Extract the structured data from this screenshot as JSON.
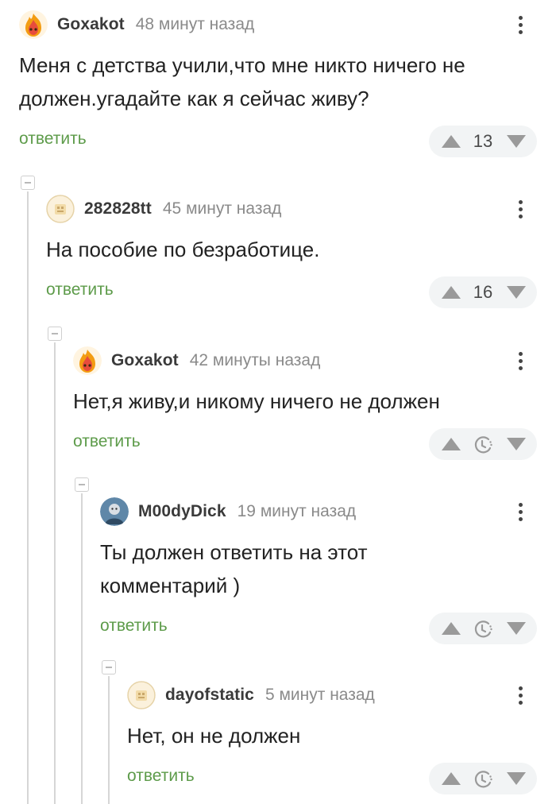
{
  "comments": [
    {
      "username": "Goxakot",
      "time": "48 минут назад",
      "text_lines": [
        "Меня с детства учили,что мне никто ничего не",
        "должен.угадайте как я сейчас живу?"
      ],
      "reply_label": "ответить",
      "rating": "13",
      "avatar_icon": "fire-emoji-avatar"
    },
    {
      "username": "282828tt",
      "time": "45 минут назад",
      "text_lines": [
        "На пособие по безработице."
      ],
      "reply_label": "ответить",
      "rating": "16",
      "avatar_icon": "default-avatar"
    },
    {
      "username": "Goxakot",
      "time": "42 минуты назад",
      "text_lines": [
        "Нет,я живу,и никому ничего не должен"
      ],
      "reply_label": "ответить",
      "rating": "",
      "avatar_icon": "fire-emoji-avatar"
    },
    {
      "username": "M00dyDick",
      "time": "19 минут назад",
      "text_lines": [
        "Ты должен ответить на этот",
        "комментарий )"
      ],
      "reply_label": "ответить",
      "rating": "",
      "avatar_icon": "photo-avatar"
    },
    {
      "username": "dayofstatic",
      "time": "5 минут назад",
      "text_lines": [
        "Нет, он не должен"
      ],
      "reply_label": "ответить",
      "rating": "",
      "avatar_icon": "default-avatar"
    }
  ],
  "colors": {
    "reply_link": "#5d9b4a",
    "vote_bg": "#f2f4f5",
    "username": "#3a3a3a",
    "time": "#8a8a8a"
  }
}
